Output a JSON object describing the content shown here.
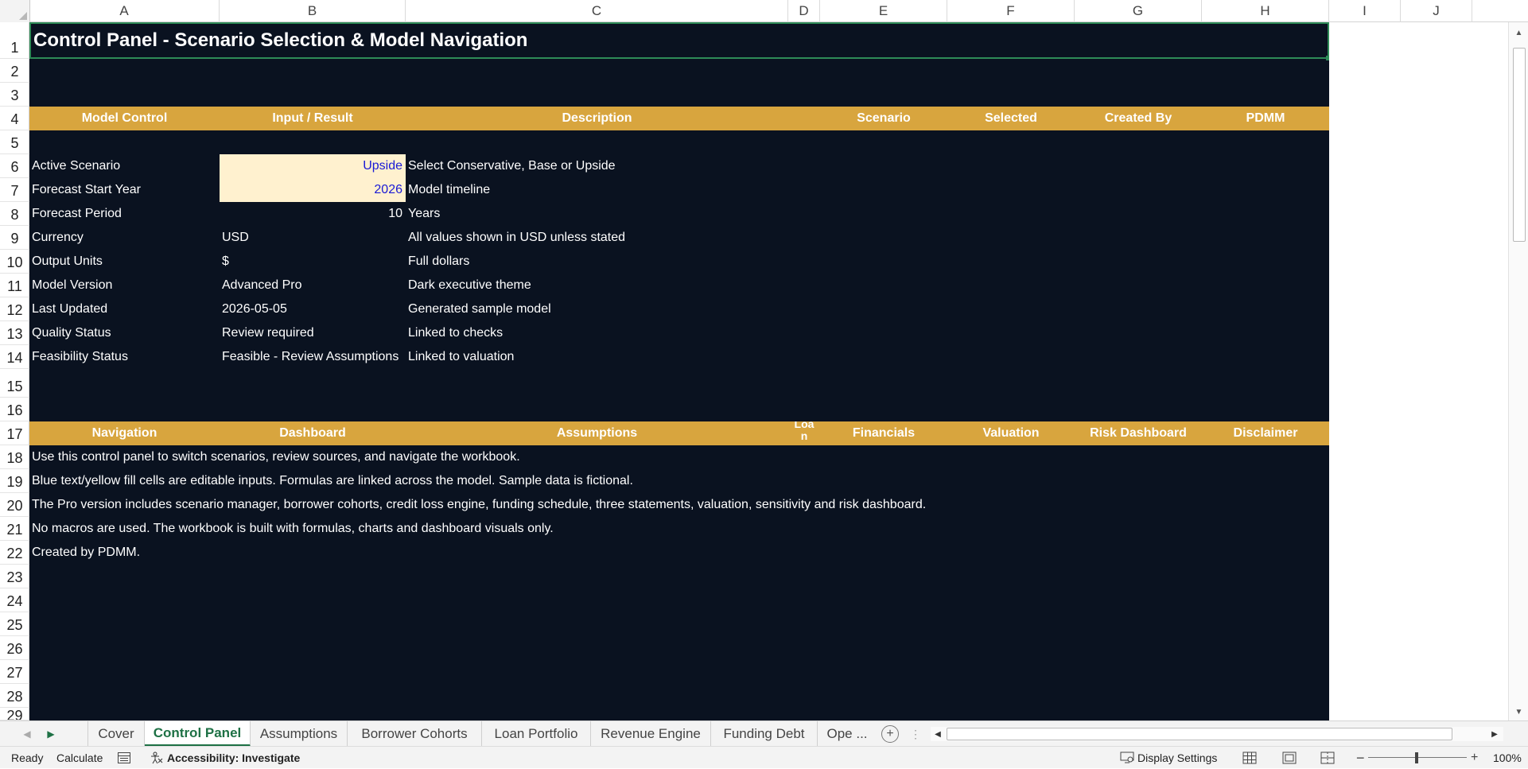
{
  "columns": [
    "A",
    "B",
    "C",
    "D",
    "E",
    "F",
    "G",
    "H",
    "I",
    "J"
  ],
  "rows": [
    "1",
    "2",
    "3",
    "4",
    "5",
    "6",
    "7",
    "8",
    "9",
    "10",
    "11",
    "12",
    "13",
    "14",
    "15",
    "16",
    "17",
    "18",
    "19",
    "20",
    "21",
    "22",
    "23",
    "24",
    "25",
    "26",
    "27",
    "28",
    "29"
  ],
  "title": "Control Panel - Scenario Selection & Model Navigation",
  "header_band": {
    "model_control": "Model Control",
    "input_result": "Input / Result",
    "description": "Description",
    "scenario": "Scenario",
    "selected": "Selected",
    "created_by": "Created By",
    "pdmm": "PDMM"
  },
  "controls": [
    {
      "label": "Active Scenario",
      "value": "Upside",
      "description": "Select Conservative, Base or Upside"
    },
    {
      "label": "Forecast Start Year",
      "value": "2026",
      "description": "Model timeline"
    },
    {
      "label": "Forecast Period",
      "value": "10",
      "description": "Years"
    },
    {
      "label": "Currency",
      "value": "USD",
      "description": "All values shown in USD unless stated"
    },
    {
      "label": "Output Units",
      "value": "$",
      "description": "Full dollars"
    },
    {
      "label": "Model Version",
      "value": "Advanced Pro",
      "description": "Dark executive theme"
    },
    {
      "label": "Last Updated",
      "value": "2026-05-05",
      "description": "Generated sample model"
    },
    {
      "label": "Quality Status",
      "value": "Review required",
      "description": "Linked to checks"
    },
    {
      "label": "Feasibility Status",
      "value": "Feasible - Review Assumptions",
      "description": "Linked to valuation"
    }
  ],
  "nav_band": {
    "navigation": "Navigation",
    "dashboard": "Dashboard",
    "assumptions": "Assumptions",
    "loan_top": "Loa",
    "loan_bottom": "n",
    "financials": "Financials",
    "valuation": "Valuation",
    "risk_dashboard": "Risk Dashboard",
    "disclaimer": "Disclaimer"
  },
  "notes": [
    "Use this control panel to switch scenarios, review sources, and navigate the workbook.",
    "Blue text/yellow fill cells are editable inputs. Formulas are linked across the model. Sample data is fictional.",
    "The Pro version includes scenario manager, borrower cohorts, credit loss engine, funding schedule, three statements, valuation, sensitivity and risk dashboard.",
    "No macros are used. The workbook is built with formulas, charts and dashboard visuals only.",
    "Created by PDMM."
  ],
  "tabs": [
    "Cover",
    "Control Panel",
    "Assumptions",
    "Borrower Cohorts",
    "Loan Portfolio",
    "Revenue Engine",
    "Funding Debt",
    "Ope ..."
  ],
  "active_tab": "Control Panel",
  "status": {
    "ready": "Ready",
    "calculate": "Calculate",
    "accessibility": "Accessibility: Investigate",
    "display_settings": "Display Settings",
    "zoom": "100%"
  },
  "colors": {
    "sheet_bg": "#0a1220",
    "band_gold": "#d8a53e",
    "input_fill": "#fff1cf",
    "input_text": "#1a1ad6",
    "active_tab": "#1e7145"
  }
}
